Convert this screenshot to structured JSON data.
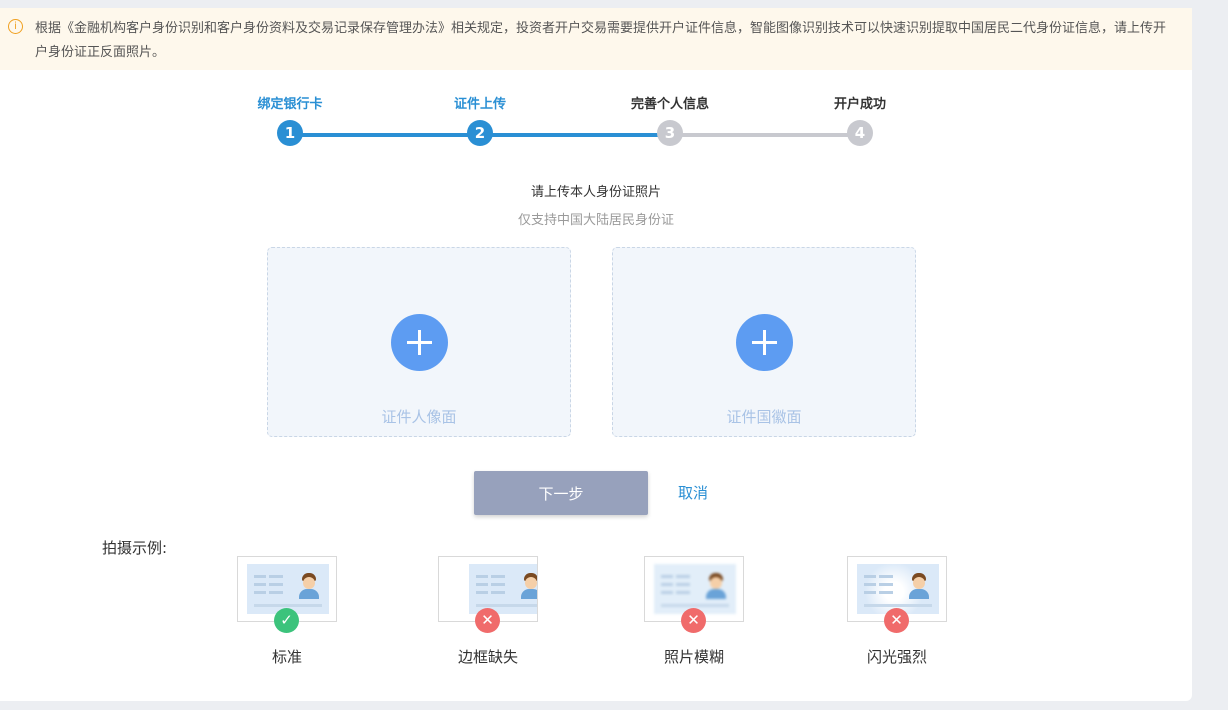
{
  "notice": {
    "icon": "info-icon",
    "text": "根据《金融机构客户身份识别和客户身份资料及交易记录保存管理办法》相关规定，投资者开户交易需要提供开户证件信息，智能图像识别技术可以快速识别提取中国居民二代身份证信息，请上传开户身份证正反面照片。"
  },
  "steps": [
    {
      "label": "绑定银行卡",
      "number": "1",
      "state": "done"
    },
    {
      "label": "证件上传",
      "number": "2",
      "state": "current"
    },
    {
      "label": "完善个人信息",
      "number": "3",
      "state": "todo"
    },
    {
      "label": "开户成功",
      "number": "4",
      "state": "todo"
    }
  ],
  "upload": {
    "title": "请上传本人身份证照片",
    "subtitle": "仅支持中国大陆居民身份证",
    "front_label": "证件人像面",
    "back_label": "证件国徽面"
  },
  "actions": {
    "next_label": "下一步",
    "cancel_label": "取消"
  },
  "examples": {
    "title": "拍摄示例:",
    "items": [
      {
        "label": "标准",
        "status": "ok",
        "icon": "check-icon"
      },
      {
        "label": "边框缺失",
        "status": "bad",
        "icon": "cross-icon"
      },
      {
        "label": "照片模糊",
        "status": "bad",
        "icon": "cross-icon"
      },
      {
        "label": "闪光强烈",
        "status": "bad",
        "icon": "cross-icon"
      }
    ]
  },
  "colors": {
    "accent": "#2a8fd4",
    "inactive": "#c8c9cf",
    "plus": "#5d9cf2",
    "ok": "#3cc37c",
    "bad": "#f06b6b"
  }
}
